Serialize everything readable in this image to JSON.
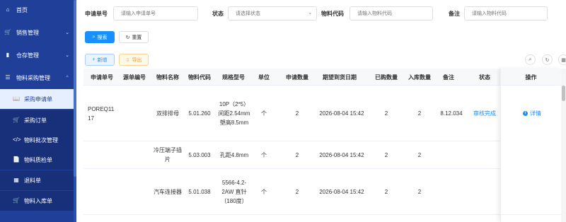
{
  "sidebar": {
    "items": [
      {
        "icon": "home-icon",
        "glyph": "⌂",
        "label": "首页"
      },
      {
        "icon": "cart-icon",
        "glyph": "🛒",
        "label": "销售管理",
        "arrow": "⌄"
      },
      {
        "icon": "bar-chart-icon",
        "glyph": "▮",
        "label": "仓存管理",
        "arrow": "⌄"
      },
      {
        "icon": "list-icon",
        "glyph": "☰",
        "label": "物料采购管理",
        "arrow": "⌃"
      }
    ],
    "sub_items": [
      {
        "icon": "book-icon",
        "glyph": "📖",
        "label": "采购申请单"
      },
      {
        "icon": "cart-icon",
        "glyph": "🛒",
        "label": "采购订单"
      },
      {
        "icon": "code-icon",
        "glyph": "</>",
        "label": "物料批次管理"
      },
      {
        "icon": "doc-icon",
        "glyph": "📄",
        "label": "物料质检单"
      },
      {
        "icon": "grid-icon",
        "glyph": "▦",
        "label": "退料单"
      },
      {
        "icon": "cart-icon",
        "glyph": "🛒",
        "label": "物料入库单"
      }
    ]
  },
  "search": {
    "apply_no_label": "申请单号",
    "apply_no_placeholder": "请输入申请单号",
    "status_label": "状态",
    "status_placeholder": "请选择状态",
    "material_code_label": "物料代码",
    "material_code_placeholder": "请输入物料代码",
    "remark_label": "备注",
    "remark_placeholder": "请输入物料代码",
    "search_button": "搜索",
    "reset_button": "重置"
  },
  "toolbar": {
    "add_button": "新增",
    "export_button": "导出"
  },
  "table": {
    "columns": [
      "申请单号",
      "源单编号",
      "物料名称",
      "物料代码",
      "规格型号",
      "单位",
      "申请数量",
      "期望到货日期",
      "已购数量",
      "入库数量",
      "备注",
      "状态"
    ],
    "action_column": "操作",
    "group": {
      "apply_no": "POREQ1117",
      "remark": "8.12.034",
      "status": "审核完成",
      "action": "详情"
    },
    "rows": [
      {
        "name": "双排排母",
        "code": "5.01.260",
        "spec": "10P（2*5）间距2.54mm 塑高8.5mm",
        "unit": "个",
        "qty": "2",
        "date": "2026-08-04 15:42",
        "bought": "2",
        "stocked": "2"
      },
      {
        "name": "冷压端子插片",
        "code": "5.03.003",
        "spec": "孔距4.8mm",
        "unit": "个",
        "qty": "2",
        "date": "2026-08-04 15:42",
        "bought": "2",
        "stocked": "2"
      },
      {
        "name": "汽车连接器",
        "code": "5.01.038",
        "spec": "5566-4.2-2AW 直针（180度）",
        "unit": "个",
        "qty": "2",
        "date": "2026-08-04 15:42",
        "bought": "2",
        "stocked": "2"
      }
    ]
  }
}
